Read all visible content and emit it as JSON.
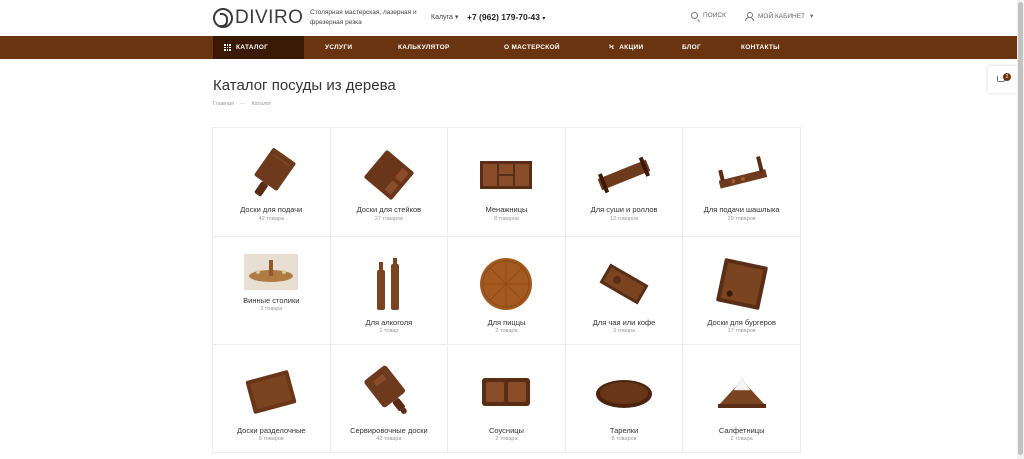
{
  "header": {
    "logo_text": "DIVIRO",
    "tagline": "Столярная мастерская, лазерная и фрезерная резка",
    "city": "Калуга",
    "phone": "+7 (962) 179-70-43",
    "search_label": "Поиск",
    "cabinet_label": "Мой кабинет"
  },
  "nav": {
    "items": [
      {
        "label": "Каталог"
      },
      {
        "label": "Услуги"
      },
      {
        "label": "Калькулятор"
      },
      {
        "label": "О мастерской"
      },
      {
        "label": "Акции"
      },
      {
        "label": "Блог"
      },
      {
        "label": "Контакты"
      }
    ]
  },
  "cart": {
    "count": "2"
  },
  "page": {
    "title": "Каталог посуды из дерева",
    "breadcrumb": [
      "Главная",
      "Каталог"
    ]
  },
  "categories": [
    {
      "name": "Доски для подачи",
      "count": "42 товара"
    },
    {
      "name": "Доски для стейков",
      "count": "27 товаров"
    },
    {
      "name": "Менажницы",
      "count": "8 товаров"
    },
    {
      "name": "Для суши и роллов",
      "count": "12 товаров"
    },
    {
      "name": "Для подачи шашлыка",
      "count": "29 товаров"
    },
    {
      "name": "Винные столики",
      "count": "3 товара"
    },
    {
      "name": "Для алкоголя",
      "count": "1 товар"
    },
    {
      "name": "Для пиццы",
      "count": "2 товара"
    },
    {
      "name": "Для чая или кофе",
      "count": "3 товара"
    },
    {
      "name": "Доски для бургеров",
      "count": "17 товаров"
    },
    {
      "name": "Доски разделочные",
      "count": "8 товаров"
    },
    {
      "name": "Сервировочные доски",
      "count": "42 товара"
    },
    {
      "name": "Соусницы",
      "count": "2 товара"
    },
    {
      "name": "Тарелки",
      "count": "8 товаров"
    },
    {
      "name": "Салфетницы",
      "count": "2 товара"
    }
  ],
  "colors": {
    "brand": "#6b3410",
    "brand_dark": "#3a1a07",
    "wood": "#6e3a1e"
  }
}
